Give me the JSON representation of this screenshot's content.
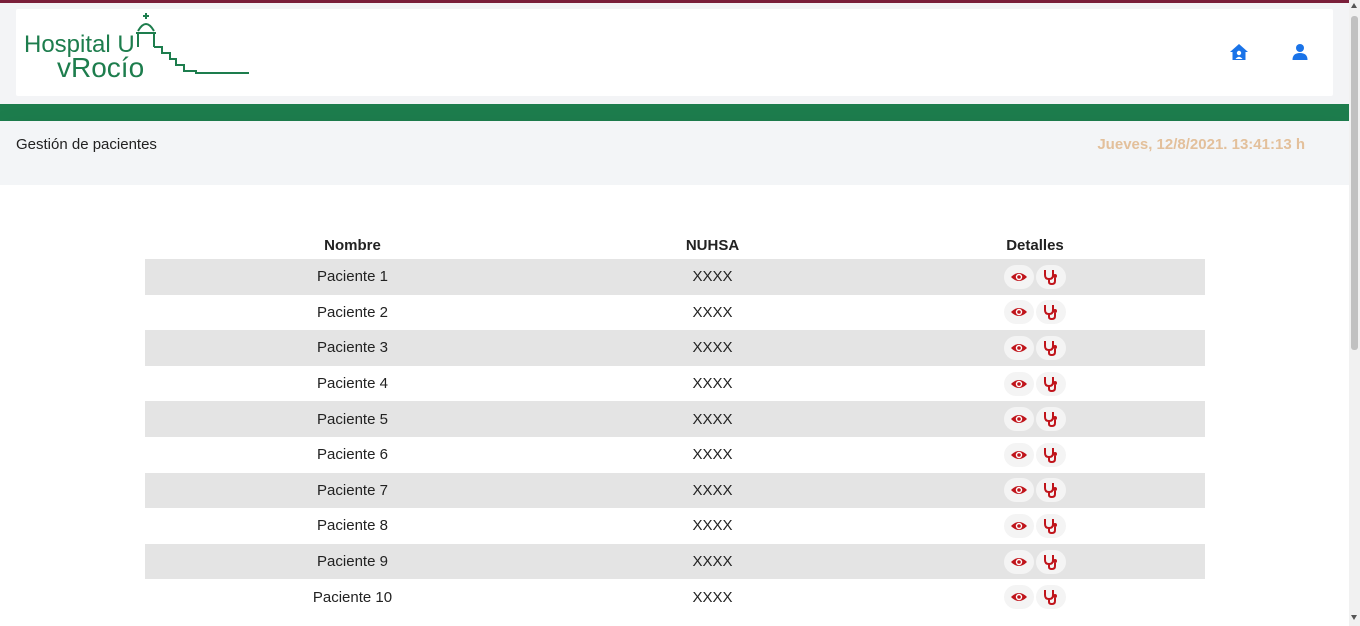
{
  "brand": {
    "logo_line1": "Hospital U",
    "logo_line2": "vRocío",
    "logo_color": "#1d7d4d"
  },
  "nav": {
    "home_icon": "home-icon",
    "user_icon": "user-icon",
    "icon_color": "#1a73e8"
  },
  "header": {
    "title": "Gestión de pacientes",
    "datetime": "Jueves, 12/8/2021. 13:41:13 h"
  },
  "table": {
    "columns": [
      "Nombre",
      "NUHSA",
      "Detalles"
    ],
    "rows": [
      {
        "name": "Paciente 1",
        "nuhsa": "XXXX"
      },
      {
        "name": "Paciente 2",
        "nuhsa": "XXXX"
      },
      {
        "name": "Paciente 3",
        "nuhsa": "XXXX"
      },
      {
        "name": "Paciente 4",
        "nuhsa": "XXXX"
      },
      {
        "name": "Paciente 5",
        "nuhsa": "XXXX"
      },
      {
        "name": "Paciente 6",
        "nuhsa": "XXXX"
      },
      {
        "name": "Paciente 7",
        "nuhsa": "XXXX"
      },
      {
        "name": "Paciente 8",
        "nuhsa": "XXXX"
      },
      {
        "name": "Paciente 9",
        "nuhsa": "XXXX"
      },
      {
        "name": "Paciente 10",
        "nuhsa": "XXXX"
      }
    ],
    "detail_icons": [
      "eye-icon",
      "stethoscope-icon"
    ],
    "detail_icon_color": "#c0141b"
  },
  "colors": {
    "accent_green": "#1d7d4d",
    "top_line": "#7a1f3a",
    "datetime": "#e3c09b",
    "stripe": "#e4e4e4"
  }
}
